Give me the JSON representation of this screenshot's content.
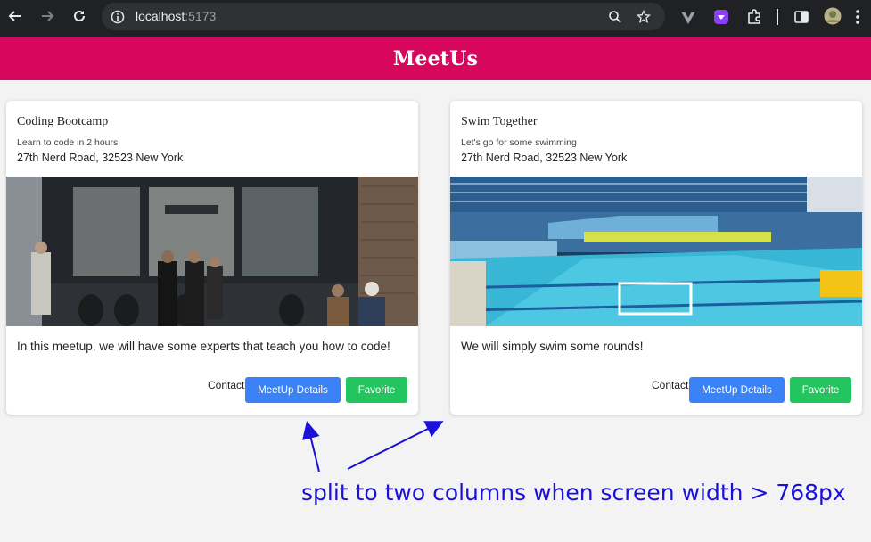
{
  "browser": {
    "url_host": "localhost",
    "url_port": ":5173"
  },
  "app": {
    "title": "MeetUs"
  },
  "meetups": [
    {
      "title": "Coding Bootcamp",
      "subtitle": "Learn to code in 2 hours",
      "address": "27th Nerd Road, 32523 New York",
      "image": "cafe storefront photo",
      "description": "In this meetup, we will have some experts that teach you how to code!",
      "contact_label": "Contact",
      "details_label": "MeetUp Details",
      "favorite_label": "Favorite"
    },
    {
      "title": "Swim Together",
      "subtitle": "Let's go for some swimming",
      "address": "27th Nerd Road, 32523 New York",
      "image": "indoor swimming pool photo",
      "description": "We will simply swim some rounds!",
      "contact_label": "Contact",
      "details_label": "MeetUp Details",
      "favorite_label": "Favorite"
    }
  ],
  "annotation": {
    "text": "split to two columns when screen width > 768px"
  },
  "colors": {
    "header": "#d6075c",
    "details_button": "#3b82f6",
    "favorite_button": "#22c55e",
    "annotation": "#1a10d8"
  }
}
